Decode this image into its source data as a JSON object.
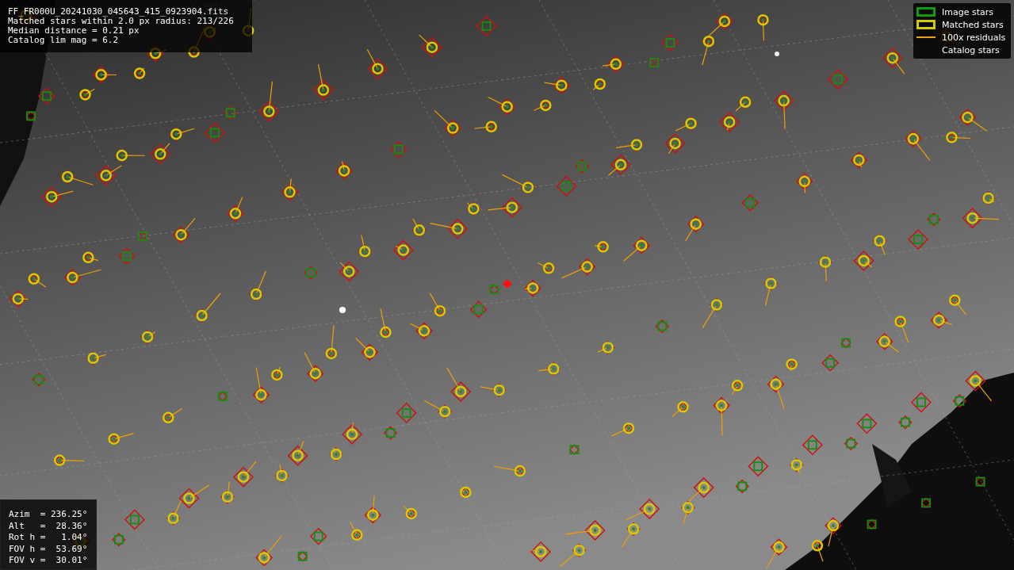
{
  "info": {
    "lines": [
      "FF_FR000U_20241030_045643_415_0923904.fits",
      "Matched stars within 2.0 px radius: 213/226",
      "Median distance = 0.21 px",
      "Catalog lim mag = 6.2"
    ]
  },
  "legend": [
    {
      "label": "Image stars"
    },
    {
      "kind": "matched",
      "label": "Matched stars"
    },
    {
      "kind": "residual",
      "label": "100x residuals"
    },
    {
      "kind": "catalog",
      "label": "Catalog stars"
    }
  ],
  "pointing": {
    "lines": [
      "Azim  = 236.25°",
      "Alt   =  28.36°",
      "Rot h =   1.04°",
      "FOV h =  53.69°",
      "FOV v =  30.01°"
    ]
  }
}
